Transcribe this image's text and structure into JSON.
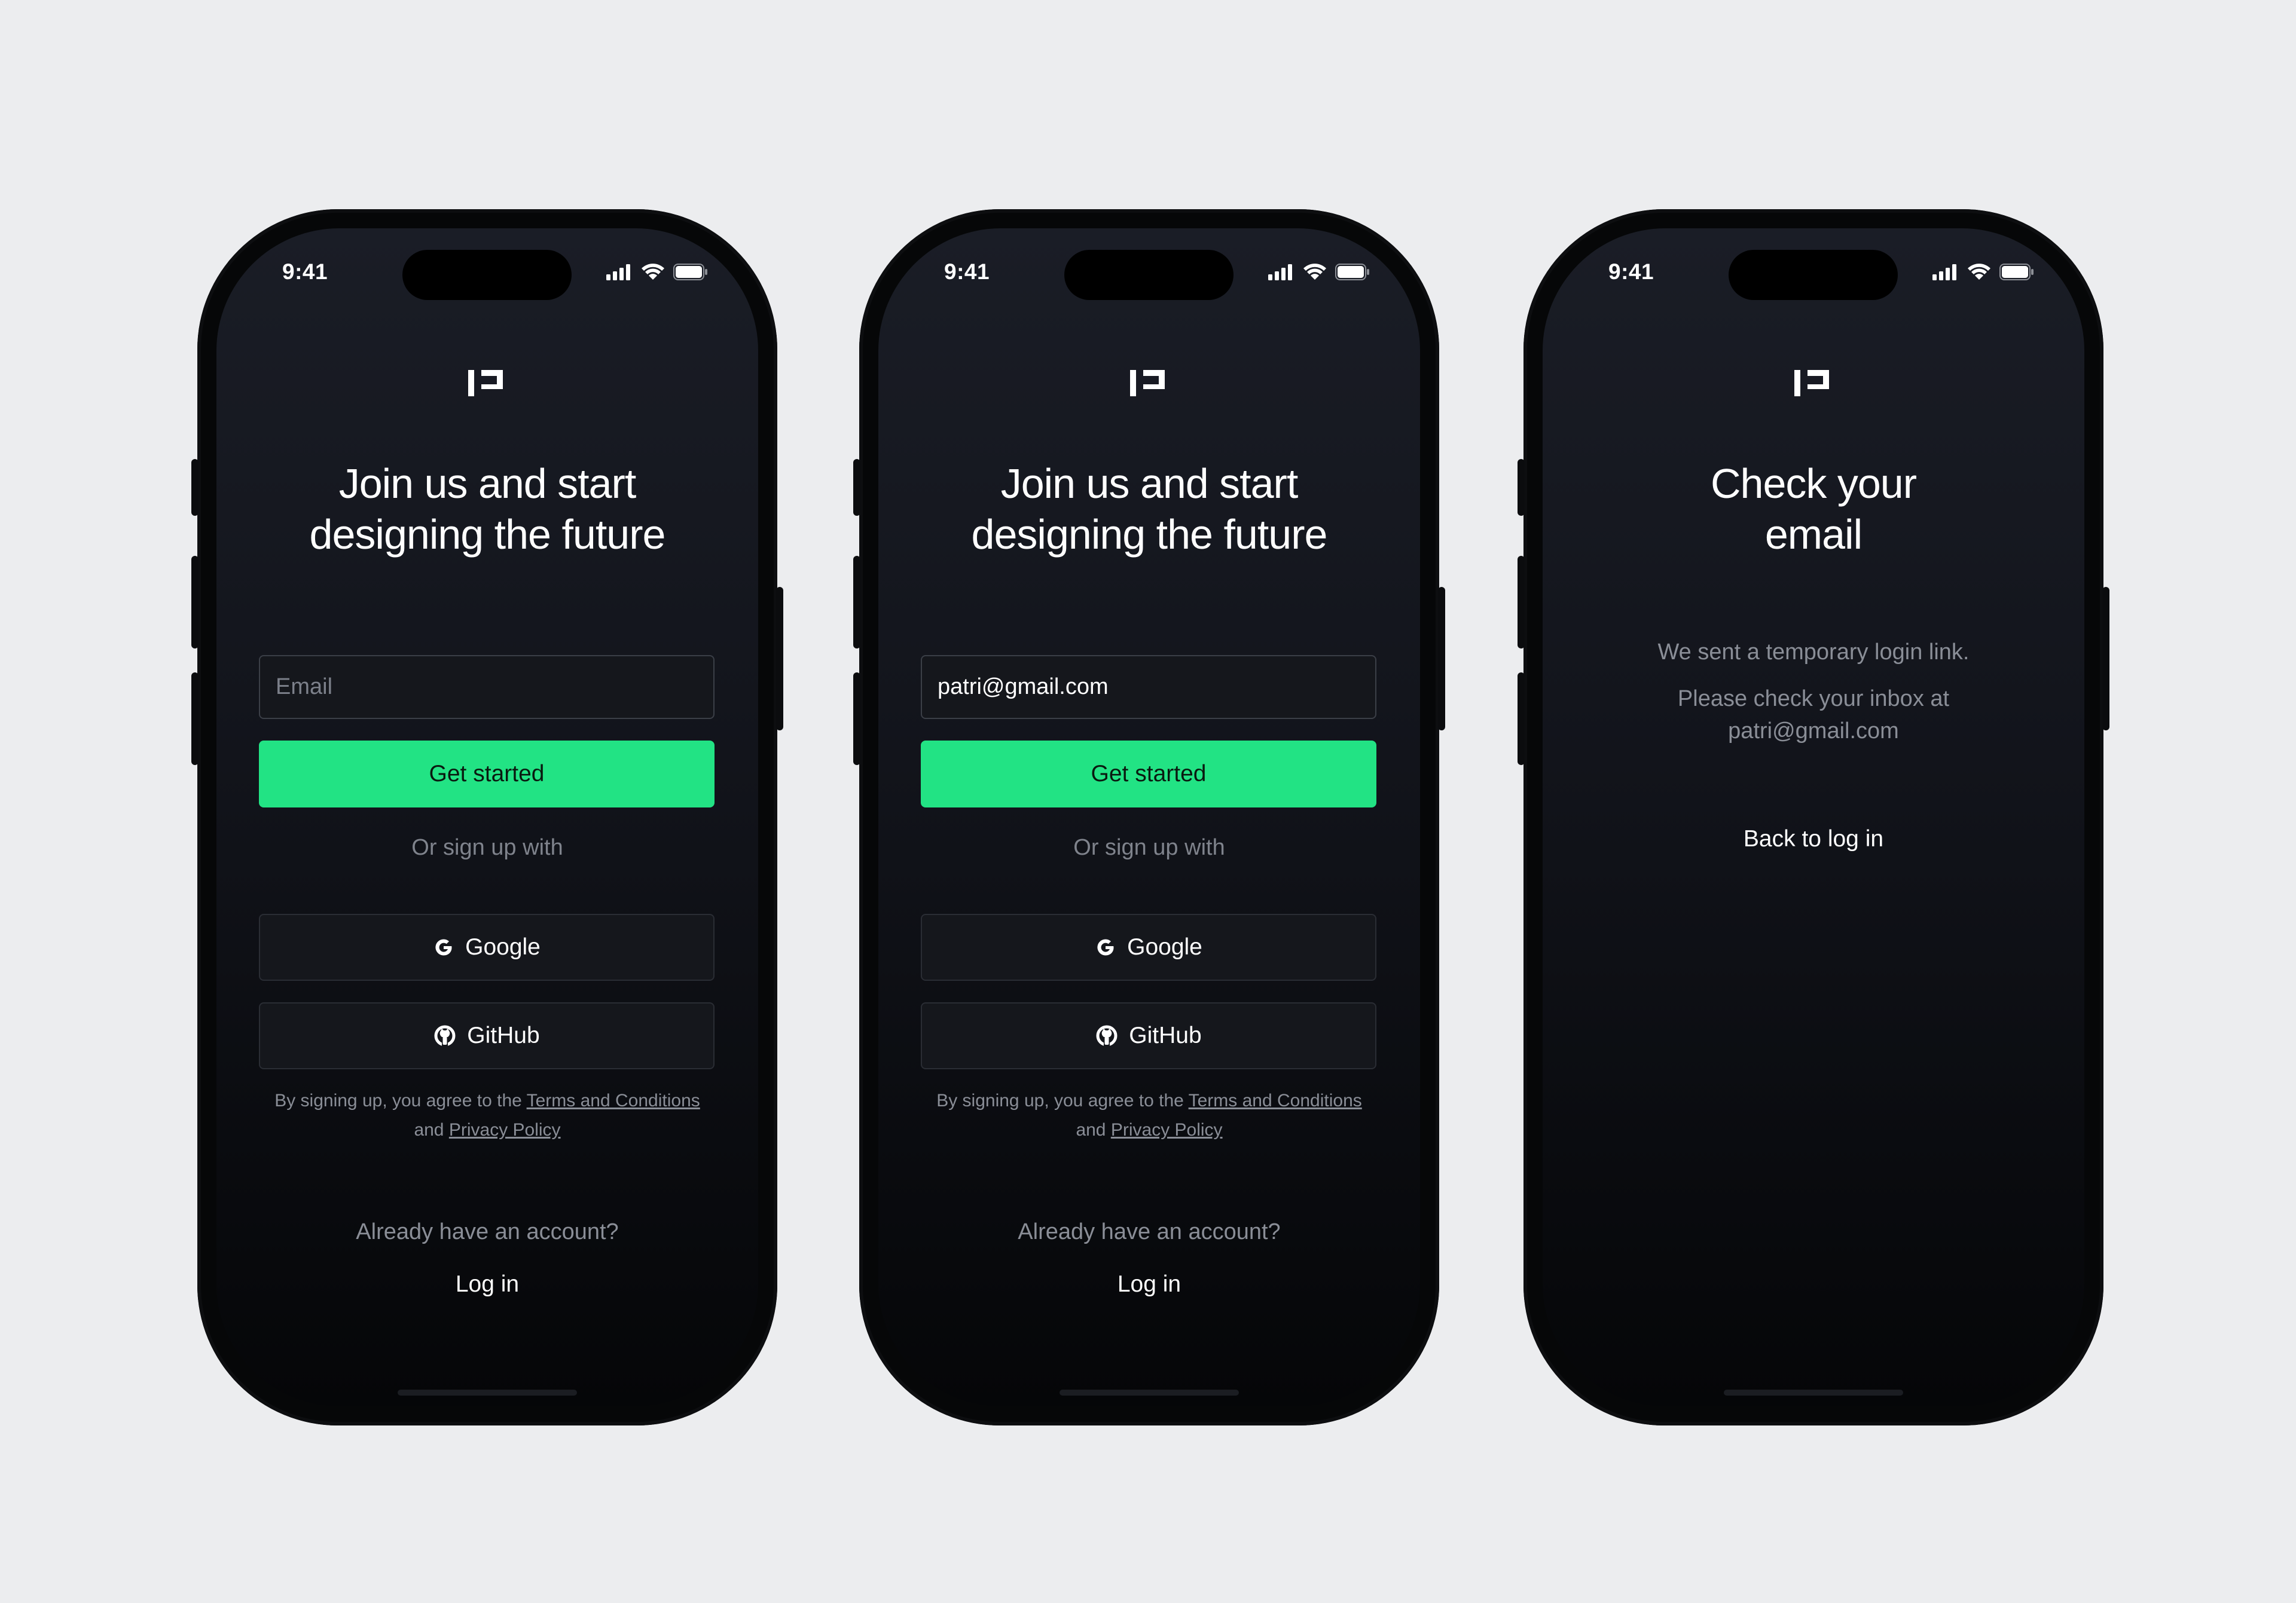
{
  "status_bar": {
    "time": "9:41"
  },
  "colors": {
    "background": "#ecedef",
    "accent": "#22e384",
    "screen_top": "#1a1d26",
    "screen_bottom": "#050608"
  },
  "icons": {
    "logo": "brand-logo-icon",
    "signal": "cellular-signal-icon",
    "wifi": "wifi-icon",
    "battery": "battery-icon",
    "google": "google-icon",
    "github": "github-icon"
  },
  "signup": {
    "title_line1": "Join us and start",
    "title_line2": "designing the future",
    "email_placeholder": "Email",
    "email_value_filled": "patri@gmail.com",
    "cta_label": "Get started",
    "or_text": "Or sign up with",
    "google_label": "Google",
    "github_label": "GitHub",
    "legal_prefix": "By signing up, you agree to the",
    "terms_link": "Terms and Conditions",
    "legal_and": "and",
    "privacy_link": "Privacy Policy",
    "account_prompt": "Already have an account?",
    "login_label": "Log in"
  },
  "check_email": {
    "title_line1": "Check your",
    "title_line2": "email",
    "line1": "We sent a temporary login link.",
    "line2": "Please check your inbox at",
    "email": "patri@gmail.com",
    "back_label": "Back to log in"
  }
}
